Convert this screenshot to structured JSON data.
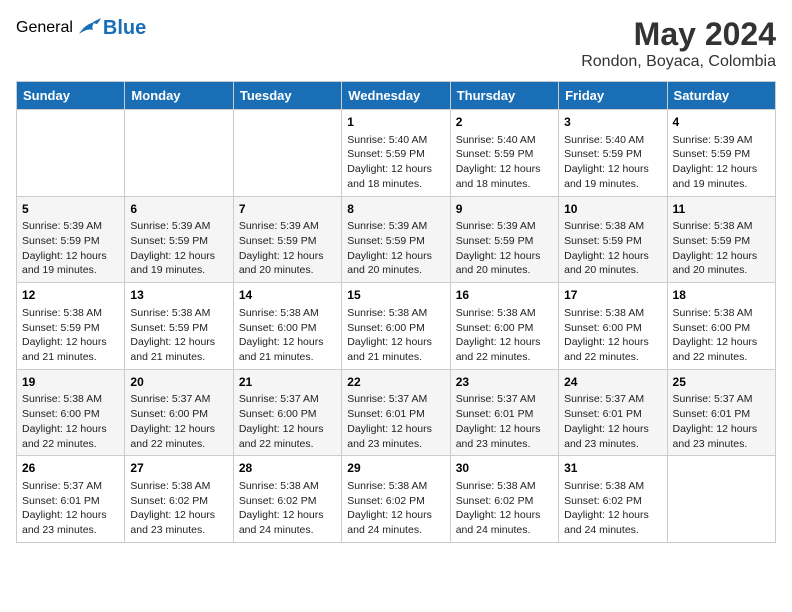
{
  "logo": {
    "general": "General",
    "blue": "Blue"
  },
  "title": {
    "month_year": "May 2024",
    "location": "Rondon, Boyaca, Colombia"
  },
  "days_of_week": [
    "Sunday",
    "Monday",
    "Tuesday",
    "Wednesday",
    "Thursday",
    "Friday",
    "Saturday"
  ],
  "weeks": [
    [
      {
        "day": "",
        "content": ""
      },
      {
        "day": "",
        "content": ""
      },
      {
        "day": "",
        "content": ""
      },
      {
        "day": "1",
        "content": "Sunrise: 5:40 AM\nSunset: 5:59 PM\nDaylight: 12 hours and 18 minutes."
      },
      {
        "day": "2",
        "content": "Sunrise: 5:40 AM\nSunset: 5:59 PM\nDaylight: 12 hours and 18 minutes."
      },
      {
        "day": "3",
        "content": "Sunrise: 5:40 AM\nSunset: 5:59 PM\nDaylight: 12 hours and 19 minutes."
      },
      {
        "day": "4",
        "content": "Sunrise: 5:39 AM\nSunset: 5:59 PM\nDaylight: 12 hours and 19 minutes."
      }
    ],
    [
      {
        "day": "5",
        "content": "Sunrise: 5:39 AM\nSunset: 5:59 PM\nDaylight: 12 hours and 19 minutes."
      },
      {
        "day": "6",
        "content": "Sunrise: 5:39 AM\nSunset: 5:59 PM\nDaylight: 12 hours and 19 minutes."
      },
      {
        "day": "7",
        "content": "Sunrise: 5:39 AM\nSunset: 5:59 PM\nDaylight: 12 hours and 20 minutes."
      },
      {
        "day": "8",
        "content": "Sunrise: 5:39 AM\nSunset: 5:59 PM\nDaylight: 12 hours and 20 minutes."
      },
      {
        "day": "9",
        "content": "Sunrise: 5:39 AM\nSunset: 5:59 PM\nDaylight: 12 hours and 20 minutes."
      },
      {
        "day": "10",
        "content": "Sunrise: 5:38 AM\nSunset: 5:59 PM\nDaylight: 12 hours and 20 minutes."
      },
      {
        "day": "11",
        "content": "Sunrise: 5:38 AM\nSunset: 5:59 PM\nDaylight: 12 hours and 20 minutes."
      }
    ],
    [
      {
        "day": "12",
        "content": "Sunrise: 5:38 AM\nSunset: 5:59 PM\nDaylight: 12 hours and 21 minutes."
      },
      {
        "day": "13",
        "content": "Sunrise: 5:38 AM\nSunset: 5:59 PM\nDaylight: 12 hours and 21 minutes."
      },
      {
        "day": "14",
        "content": "Sunrise: 5:38 AM\nSunset: 6:00 PM\nDaylight: 12 hours and 21 minutes."
      },
      {
        "day": "15",
        "content": "Sunrise: 5:38 AM\nSunset: 6:00 PM\nDaylight: 12 hours and 21 minutes."
      },
      {
        "day": "16",
        "content": "Sunrise: 5:38 AM\nSunset: 6:00 PM\nDaylight: 12 hours and 22 minutes."
      },
      {
        "day": "17",
        "content": "Sunrise: 5:38 AM\nSunset: 6:00 PM\nDaylight: 12 hours and 22 minutes."
      },
      {
        "day": "18",
        "content": "Sunrise: 5:38 AM\nSunset: 6:00 PM\nDaylight: 12 hours and 22 minutes."
      }
    ],
    [
      {
        "day": "19",
        "content": "Sunrise: 5:38 AM\nSunset: 6:00 PM\nDaylight: 12 hours and 22 minutes."
      },
      {
        "day": "20",
        "content": "Sunrise: 5:37 AM\nSunset: 6:00 PM\nDaylight: 12 hours and 22 minutes."
      },
      {
        "day": "21",
        "content": "Sunrise: 5:37 AM\nSunset: 6:00 PM\nDaylight: 12 hours and 22 minutes."
      },
      {
        "day": "22",
        "content": "Sunrise: 5:37 AM\nSunset: 6:01 PM\nDaylight: 12 hours and 23 minutes."
      },
      {
        "day": "23",
        "content": "Sunrise: 5:37 AM\nSunset: 6:01 PM\nDaylight: 12 hours and 23 minutes."
      },
      {
        "day": "24",
        "content": "Sunrise: 5:37 AM\nSunset: 6:01 PM\nDaylight: 12 hours and 23 minutes."
      },
      {
        "day": "25",
        "content": "Sunrise: 5:37 AM\nSunset: 6:01 PM\nDaylight: 12 hours and 23 minutes."
      }
    ],
    [
      {
        "day": "26",
        "content": "Sunrise: 5:37 AM\nSunset: 6:01 PM\nDaylight: 12 hours and 23 minutes."
      },
      {
        "day": "27",
        "content": "Sunrise: 5:38 AM\nSunset: 6:02 PM\nDaylight: 12 hours and 23 minutes."
      },
      {
        "day": "28",
        "content": "Sunrise: 5:38 AM\nSunset: 6:02 PM\nDaylight: 12 hours and 24 minutes."
      },
      {
        "day": "29",
        "content": "Sunrise: 5:38 AM\nSunset: 6:02 PM\nDaylight: 12 hours and 24 minutes."
      },
      {
        "day": "30",
        "content": "Sunrise: 5:38 AM\nSunset: 6:02 PM\nDaylight: 12 hours and 24 minutes."
      },
      {
        "day": "31",
        "content": "Sunrise: 5:38 AM\nSunset: 6:02 PM\nDaylight: 12 hours and 24 minutes."
      },
      {
        "day": "",
        "content": ""
      }
    ]
  ]
}
